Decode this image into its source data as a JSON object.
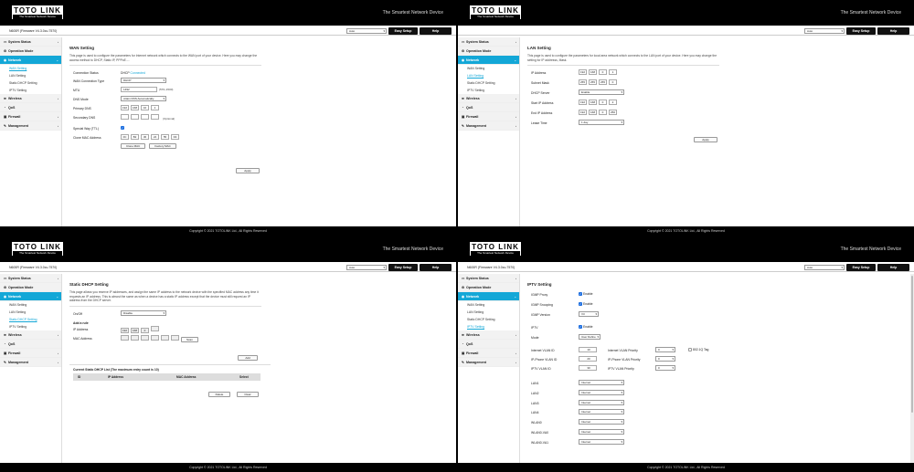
{
  "brand": {
    "logo": "TOTO LINK",
    "logo_sub": "The Smartest Network Device",
    "tagline": "The Smartest Network Device"
  },
  "topbar": {
    "model": "N600R (Firmware V4.3.0cu.7570)",
    "lang": "Auto",
    "easy_setup": "Easy Setup",
    "help": "Help"
  },
  "menu": {
    "system_status": "System Status",
    "operation_mode": "Operation Mode",
    "network": "Network",
    "wan": "WAN Setting",
    "lan": "LAN Setting",
    "dhcp": "Static DHCP Setting",
    "iptv": "IPTV Setting",
    "wireless": "Wireless",
    "qos": "QoS",
    "firewall": "Firewall",
    "management": "Management"
  },
  "icons": {
    "system": "monitor-icon",
    "operation": "gear-icon",
    "network": "globe-icon",
    "wireless": "wifi-icon",
    "qos": "gauge-icon",
    "firewall": "shield-icon",
    "management": "wrench-icon"
  },
  "footer": "Copyright © 2021 TOTOLINK Ltd., All Rights Reserved",
  "wan": {
    "title": "WAN Setting",
    "desc": "This page is used to configure the parameters for Internet network which connects to the WAN port of your device. Here you may change the access method to DHCP, Static IP, PPPoE....",
    "status_label": "Connection Status",
    "status_type": "DHCP",
    "status_value": "Connected",
    "type_label": "WAN Connection Type",
    "type_value": "DHCP",
    "mtu_label": "MTU",
    "mtu_value": "1492",
    "mtu_hint": "(576~1500)",
    "dns_mode_label": "DNS Mode",
    "dns_mode_value": "Attain DNS Automatically",
    "primary_label": "Primary DNS",
    "primary": [
      "192",
      "168",
      "10",
      "1"
    ],
    "secondary_label": "Secondary DNS",
    "secondary": [
      "",
      "",
      "",
      ""
    ],
    "optional": "(Optional)",
    "ttl_label": "Special Way (TTL)",
    "mac_label": "Clone MAC Address",
    "mac": [
      "0C",
      "B2",
      "30",
      "24",
      "55",
      "D4"
    ],
    "clone_btn": "Clone MAC",
    "factory_btn": "Factory MAC",
    "apply": "Apply"
  },
  "lan": {
    "title": "LAN Setting",
    "desc": "This page is used to configure the parameters for local area network which connects to the LAN port of your device. Here you may change the setting for IP addresss, Mask.",
    "ip_label": "IP Address",
    "ip": [
      "192",
      "168",
      "0",
      "1"
    ],
    "mask_label": "Subnet Mask",
    "mask": [
      "255",
      "255",
      "255",
      "0"
    ],
    "dhcp_label": "DHCP Server",
    "dhcp_value": "Enable",
    "start_label": "Start IP Address",
    "start": [
      "192",
      "168",
      "0",
      "2"
    ],
    "end_label": "End IP Address",
    "end": [
      "192",
      "168",
      "0",
      "250"
    ],
    "lease_label": "Lease Time",
    "lease_value": "1 day",
    "apply": "Apply"
  },
  "dhcp": {
    "title": "Static DHCP Setting",
    "desc": "This page allows you reserve IP addresses, and assign the same IP address to the network device with the specified MAC address any time it requests an IP address. This is almost the same as when a device has a static IP address except that the device must still request an IP address from the DHCP server.",
    "onoff_label": "On/Off",
    "onoff_value": "Disable",
    "add_rule": "Add a rule",
    "ip_label": "IP Address",
    "ip": [
      "192",
      "168",
      "0",
      ""
    ],
    "mac_label": "MAC Address",
    "mac": [
      "",
      "",
      "",
      "",
      "",
      ""
    ],
    "scan": "Scan",
    "add_btn": "Add",
    "list_title": "Current Static DHCP List (The maximum entry count is 10)",
    "cols": [
      "ID",
      "IP Address",
      "MAC Address",
      "Select"
    ],
    "delete_btn": "Delete",
    "clear_btn": "Clear"
  },
  "iptv": {
    "title": "IPTV Setting",
    "igmp_proxy_label": "IGMP Proxy",
    "igmp_snoop_label": "IGMP Snooping",
    "enable": "Enable",
    "igmp_ver_label": "IGMP Version",
    "igmp_ver": "V3",
    "iptv_label": "IPTV",
    "mode_label": "Mode",
    "mode_value": "User Define",
    "inet_vid_label": "Internet VLAN ID",
    "inet_vid": "10",
    "inet_pri_label": "Internet VLAN Priority",
    "inet_pri": "0",
    "tag_label": "802.1Q Tag",
    "phone_vid_label": "IP-Phone VLAN ID",
    "phone_vid": "20",
    "phone_pri_label": "IP-Phone VLAN Priority",
    "phone_pri": "0",
    "iptv_vid_label": "IPTV VLAN ID",
    "iptv_vid": "30",
    "iptv_pri_label": "IPTV VLAN Priority",
    "iptv_pri": "0",
    "ports": [
      {
        "name": "LAN1",
        "value": "Internet"
      },
      {
        "name": "LAN2",
        "value": "Internet"
      },
      {
        "name": "LAN3",
        "value": "Internet"
      },
      {
        "name": "LAN4",
        "value": "Internet"
      },
      {
        "name": "WLAN0",
        "value": "Internet"
      },
      {
        "name": "WLAN0-VA0",
        "value": "Internet"
      },
      {
        "name": "WLAN0-VA1",
        "value": "Internet"
      }
    ]
  }
}
